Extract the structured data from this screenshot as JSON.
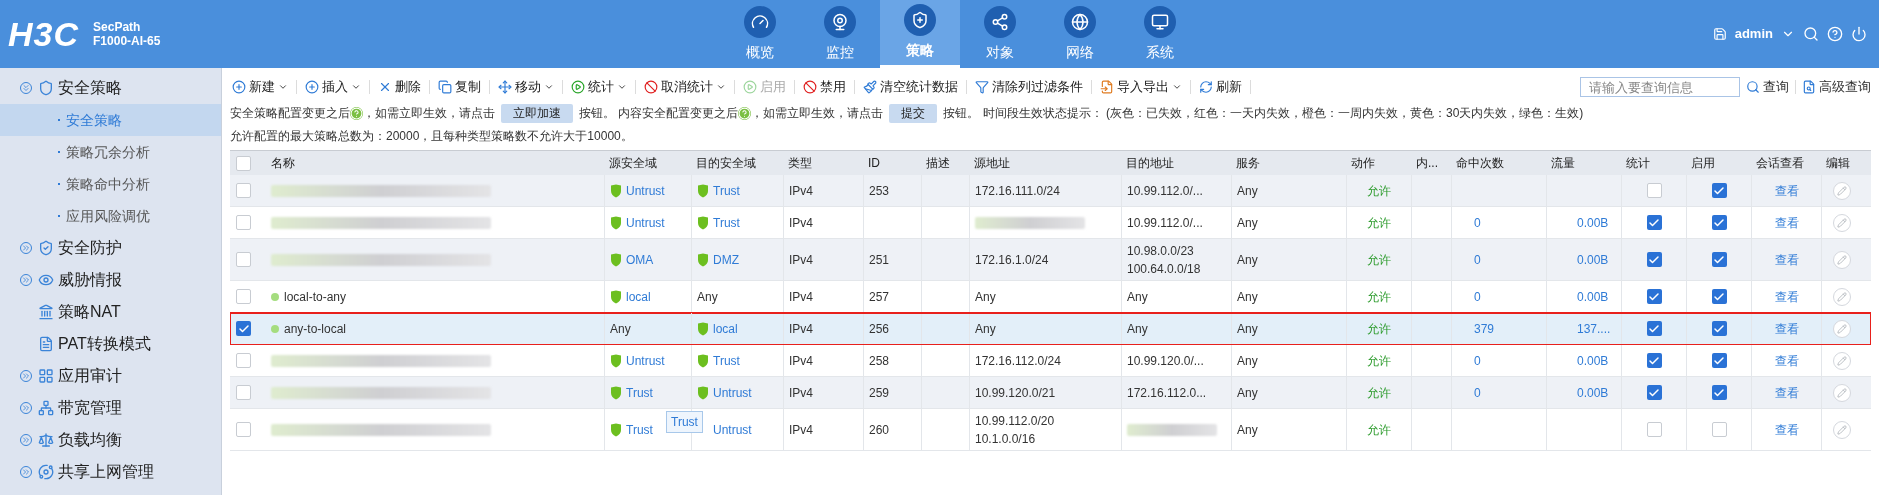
{
  "header": {
    "logo": "H3C",
    "product_line": "SecPath",
    "model": "F1000-AI-65",
    "nav": [
      {
        "label": "概览",
        "selected": false
      },
      {
        "label": "监控",
        "selected": false
      },
      {
        "label": "策略",
        "selected": true
      },
      {
        "label": "对象",
        "selected": false
      },
      {
        "label": "网络",
        "selected": false
      },
      {
        "label": "系统",
        "selected": false
      }
    ],
    "user": "admin"
  },
  "sidebar": {
    "items": [
      {
        "kind": "group",
        "label": "安全策略",
        "expanded": true,
        "selected": false
      },
      {
        "kind": "sub",
        "label": "安全策略",
        "selected": true
      },
      {
        "kind": "sub",
        "label": "策略冗余分析",
        "selected": false
      },
      {
        "kind": "sub",
        "label": "策略命中分析",
        "selected": false
      },
      {
        "kind": "sub",
        "label": "应用风险调优",
        "selected": false
      },
      {
        "kind": "group",
        "label": "安全防护",
        "expanded": false,
        "selected": false
      },
      {
        "kind": "group",
        "label": "威胁情报",
        "expanded": false,
        "selected": false
      },
      {
        "kind": "leaf",
        "label": "策略NAT",
        "selected": false
      },
      {
        "kind": "leaf",
        "label": "PAT转换模式",
        "selected": false
      },
      {
        "kind": "group",
        "label": "应用审计",
        "expanded": false,
        "selected": false
      },
      {
        "kind": "group",
        "label": "带宽管理",
        "expanded": false,
        "selected": false
      },
      {
        "kind": "group",
        "label": "负载均衡",
        "expanded": false,
        "selected": false
      },
      {
        "kind": "group",
        "label": "共享上网管理",
        "expanded": false,
        "selected": false
      }
    ]
  },
  "toolbar": {
    "buttons": [
      {
        "label": "新建",
        "dropdown": true,
        "disabled": false
      },
      {
        "label": "插入",
        "dropdown": true,
        "disabled": false
      },
      {
        "label": "删除",
        "dropdown": false,
        "disabled": false
      },
      {
        "label": "复制",
        "dropdown": false,
        "disabled": false
      },
      {
        "label": "移动",
        "dropdown": true,
        "disabled": false
      },
      {
        "label": "统计",
        "dropdown": true,
        "disabled": false
      },
      {
        "label": "取消统计",
        "dropdown": true,
        "disabled": false
      },
      {
        "label": "启用",
        "dropdown": false,
        "disabled": true
      },
      {
        "label": "禁用",
        "dropdown": false,
        "disabled": false
      },
      {
        "label": "清空统计数据",
        "dropdown": false,
        "disabled": false
      },
      {
        "label": "清除列过滤条件",
        "dropdown": false,
        "disabled": false
      },
      {
        "label": "导入导出",
        "dropdown": true,
        "disabled": false
      },
      {
        "label": "刷新",
        "dropdown": false,
        "disabled": false
      }
    ],
    "search": {
      "placeholder": "请输入要查询信息"
    },
    "search_button": "查询",
    "advanced_search": "高级查询"
  },
  "notice": [
    {
      "kind": "text",
      "text": "安全策略配置变更之后"
    },
    {
      "kind": "help"
    },
    {
      "kind": "text",
      "text": "，如需立即生效，请点击"
    },
    {
      "kind": "button",
      "text": "立即加速"
    },
    {
      "kind": "text",
      "text": "按钮。 内容安全配置变更之后"
    },
    {
      "kind": "help"
    },
    {
      "kind": "text",
      "text": "，如需立即生效，请点击"
    },
    {
      "kind": "button",
      "text": "提交"
    },
    {
      "kind": "text",
      "text": "按钮。 时间段生效状态提示： (灰色：已失效，红色：一天内失效，橙色：一周内失效，黄色：30天内失效，绿色：生效)"
    }
  ],
  "limit_note": "允许配置的最大策略总数为：20000，且每种类型策略数不允许大于10000。",
  "table": {
    "all_checked": false,
    "columns": [
      "名称",
      "源安全域",
      "目的安全域",
      "类型",
      "ID",
      "描述",
      "源地址",
      "目的地址",
      "服务",
      "动作",
      "内...",
      "命中次数",
      "流量",
      "统计",
      "启用",
      "会话查看",
      "编辑"
    ],
    "rows": [
      {
        "selected": false,
        "annotated": false,
        "name_hidden": true,
        "src_zone": {
          "kind": "zone",
          "text": "Untrust"
        },
        "dst_zone": {
          "kind": "zone",
          "text": "Trust"
        },
        "type": "IPv4",
        "id": "253",
        "src_addr": [
          "172.16.111.0/24"
        ],
        "src_hidden": false,
        "dst_addr": [
          "10.99.112.0/..."
        ],
        "dst_hidden": false,
        "service": "Any",
        "action": "允许",
        "hits": "",
        "flow": "",
        "stats": false,
        "enabled": true,
        "session": "查看"
      },
      {
        "selected": false,
        "annotated": false,
        "name_hidden": true,
        "src_zone": {
          "kind": "zone",
          "text": "Untrust"
        },
        "dst_zone": {
          "kind": "zone",
          "text": "Trust"
        },
        "type": "IPv4",
        "id": "",
        "src_addr": [],
        "src_hidden": true,
        "dst_addr": [
          "10.99.112.0/..."
        ],
        "dst_hidden": false,
        "service": "Any",
        "action": "允许",
        "hits": "0",
        "flow": "0.00B",
        "stats": true,
        "enabled": true,
        "session": "查看"
      },
      {
        "selected": false,
        "annotated": false,
        "name_hidden": true,
        "src_zone": {
          "kind": "zone",
          "text": "OMA"
        },
        "dst_zone": {
          "kind": "zone",
          "text": "DMZ"
        },
        "type": "IPv4",
        "id": "251",
        "src_addr": [
          "172.16.1.0/24"
        ],
        "src_hidden": false,
        "dst_addr": [
          "10.98.0.0/23",
          "100.64.0.0/18"
        ],
        "dst_hidden": false,
        "service": "Any",
        "action": "允许",
        "hits": "0",
        "flow": "0.00B",
        "stats": true,
        "enabled": true,
        "session": "查看"
      },
      {
        "selected": false,
        "annotated": false,
        "name_hidden": false,
        "name": "local-to-any",
        "src_zone": {
          "kind": "zone",
          "text": "local"
        },
        "dst_zone": {
          "kind": "any",
          "text": "Any"
        },
        "type": "IPv4",
        "id": "257",
        "src_addr": [
          "Any"
        ],
        "src_hidden": false,
        "dst_addr": [
          "Any"
        ],
        "dst_hidden": false,
        "service": "Any",
        "action": "允许",
        "hits": "0",
        "flow": "0.00B",
        "stats": true,
        "enabled": true,
        "session": "查看"
      },
      {
        "selected": true,
        "annotated": true,
        "name_hidden": false,
        "name": "any-to-local",
        "src_zone": {
          "kind": "any",
          "text": "Any"
        },
        "dst_zone": {
          "kind": "zone",
          "text": "local"
        },
        "type": "IPv4",
        "id": "256",
        "src_addr": [
          "Any"
        ],
        "src_hidden": false,
        "dst_addr": [
          "Any"
        ],
        "dst_hidden": false,
        "service": "Any",
        "action": "允许",
        "hits": "379",
        "flow": "137....",
        "stats": true,
        "enabled": true,
        "session": "查看"
      },
      {
        "selected": false,
        "annotated": false,
        "name_hidden": true,
        "src_zone": {
          "kind": "zone",
          "text": "Untrust"
        },
        "dst_zone": {
          "kind": "zone",
          "text": "Trust"
        },
        "type": "IPv4",
        "id": "258",
        "src_addr": [
          "172.16.112.0/24"
        ],
        "src_hidden": false,
        "dst_addr": [
          "10.99.120.0/..."
        ],
        "dst_hidden": false,
        "service": "Any",
        "action": "允许",
        "hits": "0",
        "flow": "0.00B",
        "stats": true,
        "enabled": true,
        "session": "查看"
      },
      {
        "selected": false,
        "annotated": false,
        "name_hidden": true,
        "src_zone": {
          "kind": "zone",
          "text": "Trust"
        },
        "dst_zone": {
          "kind": "zone",
          "text": "Untrust"
        },
        "type": "IPv4",
        "id": "259",
        "src_addr": [
          "10.99.120.0/21"
        ],
        "src_hidden": false,
        "dst_addr": [
          "172.16.112.0..."
        ],
        "dst_hidden": false,
        "service": "Any",
        "action": "允许",
        "hits": "0",
        "flow": "0.00B",
        "stats": true,
        "enabled": true,
        "session": "查看"
      },
      {
        "selected": false,
        "annotated": false,
        "name_hidden": true,
        "src_zone": {
          "kind": "zone",
          "text": "Trust"
        },
        "dst_zone": {
          "kind": "link",
          "text": "Untrust"
        },
        "type": "IPv4",
        "id": "260",
        "src_addr": [
          "10.99.112.0/20",
          "10.1.0.0/16"
        ],
        "src_hidden": false,
        "dst_addr": [],
        "dst_hidden": true,
        "service": "Any",
        "action": "允许",
        "hits": "",
        "flow": "",
        "stats": false,
        "enabled": false,
        "session": "查看",
        "tooltip": "Trust"
      }
    ]
  }
}
